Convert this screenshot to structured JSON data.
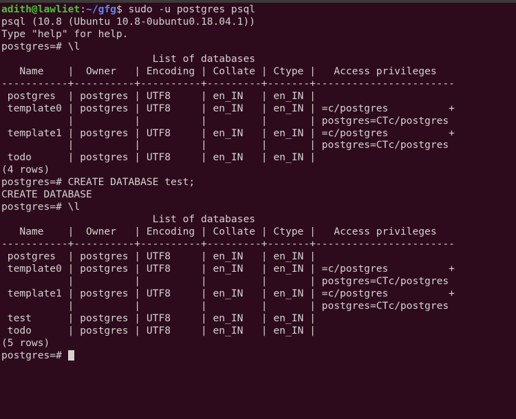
{
  "terminal": {
    "background_color": "#2d0b1d",
    "foreground_color": "#d6d2d0",
    "prompt_user_color": "#4ec03a",
    "prompt_path_color": "#5f87f7",
    "shell_prompt": {
      "user_host": "adith@lawliet",
      "separator": ":",
      "path": "~/gfg",
      "sigil": "$"
    },
    "psql_prompt": "postgres=#",
    "lines": {
      "l01_command": " sudo -u postgres psql",
      "l02_version": "psql (10.8 (Ubuntu 10.8-0ubuntu0.18.04.1))",
      "l03_help": "Type \"help\" for help.",
      "l04_blank": "",
      "l05_cmd_list": " \\l",
      "l06_title": "                         List of databases",
      "l07_header": "   Name    |  Owner   | Encoding | Collate | Ctype |   Access privileges",
      "l08_sep": "-----------+----------+----------+---------+-------+-----------------------",
      "l09_row": " postgres  | postgres | UTF8     | en_IN   | en_IN |",
      "l10_row": " template0 | postgres | UTF8     | en_IN   | en_IN | =c/postgres          +",
      "l11_cont": "           |          |          |         |       | postgres=CTc/postgres",
      "l12_row": " template1 | postgres | UTF8     | en_IN   | en_IN | =c/postgres          +",
      "l13_cont": "           |          |          |         |       | postgres=CTc/postgres",
      "l14_row": " todo      | postgres | UTF8     | en_IN   | en_IN |",
      "l15_count": "(4 rows)",
      "l16_blank": "",
      "l17_cmd_create": " CREATE DATABASE test;",
      "l18_result": "CREATE DATABASE",
      "l19_cmd_list": " \\l",
      "l20_title": "                         List of databases",
      "l21_header": "   Name    |  Owner   | Encoding | Collate | Ctype |   Access privileges",
      "l22_sep": "-----------+----------+----------+---------+-------+-----------------------",
      "l23_row": " postgres  | postgres | UTF8     | en_IN   | en_IN |",
      "l24_row": " template0 | postgres | UTF8     | en_IN   | en_IN | =c/postgres          +",
      "l25_cont": "           |          |          |         |       | postgres=CTc/postgres",
      "l26_row": " template1 | postgres | UTF8     | en_IN   | en_IN | =c/postgres          +",
      "l27_cont": "           |          |          |         |       | postgres=CTc/postgres",
      "l28_row": " test      | postgres | UTF8     | en_IN   | en_IN |",
      "l29_row": " todo      | postgres | UTF8     | en_IN   | en_IN |",
      "l30_count": "(5 rows)",
      "l31_blank": "",
      "l32_final": " "
    },
    "tables": [
      {
        "title": "List of databases",
        "columns": [
          "Name",
          "Owner",
          "Encoding",
          "Collate",
          "Ctype",
          "Access privileges"
        ],
        "rows": [
          {
            "name": "postgres",
            "owner": "postgres",
            "encoding": "UTF8",
            "collate": "en_IN",
            "ctype": "en_IN",
            "privileges": ""
          },
          {
            "name": "template0",
            "owner": "postgres",
            "encoding": "UTF8",
            "collate": "en_IN",
            "ctype": "en_IN",
            "privileges": "=c/postgres\npostgres=CTc/postgres"
          },
          {
            "name": "template1",
            "owner": "postgres",
            "encoding": "UTF8",
            "collate": "en_IN",
            "ctype": "en_IN",
            "privileges": "=c/postgres\npostgres=CTc/postgres"
          },
          {
            "name": "todo",
            "owner": "postgres",
            "encoding": "UTF8",
            "collate": "en_IN",
            "ctype": "en_IN",
            "privileges": ""
          }
        ],
        "row_count_label": "(4 rows)"
      },
      {
        "title": "List of databases",
        "columns": [
          "Name",
          "Owner",
          "Encoding",
          "Collate",
          "Ctype",
          "Access privileges"
        ],
        "rows": [
          {
            "name": "postgres",
            "owner": "postgres",
            "encoding": "UTF8",
            "collate": "en_IN",
            "ctype": "en_IN",
            "privileges": ""
          },
          {
            "name": "template0",
            "owner": "postgres",
            "encoding": "UTF8",
            "collate": "en_IN",
            "ctype": "en_IN",
            "privileges": "=c/postgres\npostgres=CTc/postgres"
          },
          {
            "name": "template1",
            "owner": "postgres",
            "encoding": "UTF8",
            "collate": "en_IN",
            "ctype": "en_IN",
            "privileges": "=c/postgres\npostgres=CTc/postgres"
          },
          {
            "name": "test",
            "owner": "postgres",
            "encoding": "UTF8",
            "collate": "en_IN",
            "ctype": "en_IN",
            "privileges": ""
          },
          {
            "name": "todo",
            "owner": "postgres",
            "encoding": "UTF8",
            "collate": "en_IN",
            "ctype": "en_IN",
            "privileges": ""
          }
        ],
        "row_count_label": "(5 rows)"
      }
    ]
  }
}
